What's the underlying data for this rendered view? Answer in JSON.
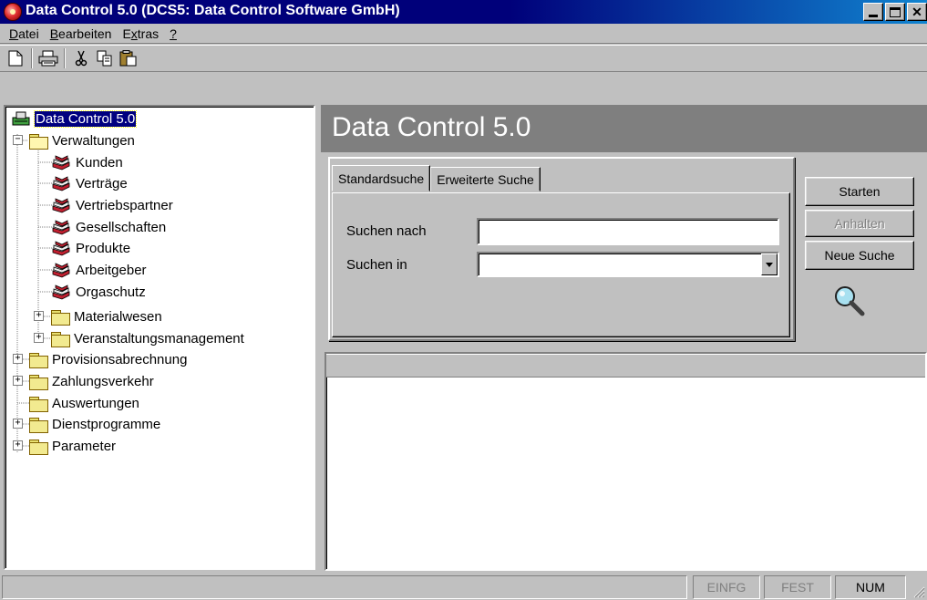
{
  "window": {
    "title": "Data Control 5.0 (DCS5: Data Control Software GmbH)"
  },
  "menu": [
    {
      "label": "Datei",
      "accel": "D",
      "rest": "atei"
    },
    {
      "label": "Bearbeiten",
      "accel": "B",
      "rest": "earbeiten"
    },
    {
      "label": "Extras",
      "pre": "E",
      "accel": "x",
      "rest": "tras"
    },
    {
      "label": "?",
      "accel": "?",
      "rest": ""
    }
  ],
  "toolbar": [
    "new-document-icon",
    "print-icon",
    "cut-icon",
    "copy-icon",
    "paste-icon"
  ],
  "tree": {
    "root": "Data Control 5.0",
    "verwaltungen": "Verwaltungen",
    "verwaltungen_items": [
      "Kunden",
      "Verträge",
      "Vertriebspartner",
      "Gesellschaften",
      "Produkte",
      "Arbeitgeber",
      "Orgaschutz"
    ],
    "sub_folders": [
      "Materialwesen",
      "Veranstaltungsmanagement"
    ],
    "top_folders": [
      "Provisionsabrechnung",
      "Zahlungsverkehr",
      "Auswertungen",
      "Dienstprogramme",
      "Parameter"
    ]
  },
  "header": {
    "title": "Data Control 5.0"
  },
  "search": {
    "tabs": [
      "Standardsuche",
      "Erweiterte Suche"
    ],
    "active_tab": "Standardsuche",
    "search_for_label": "Suchen nach",
    "search_for_value": "",
    "search_in_label": "Suchen in",
    "search_in_value": ""
  },
  "buttons": {
    "start": "Starten",
    "stop": "Anhalten",
    "new_search": "Neue Suche"
  },
  "status": {
    "ins": "EINFG",
    "caps": "FEST",
    "num": "NUM"
  },
  "colors": {
    "titlebar": "#00007a",
    "header_band": "#7f7f7f",
    "selection": "#000080"
  }
}
